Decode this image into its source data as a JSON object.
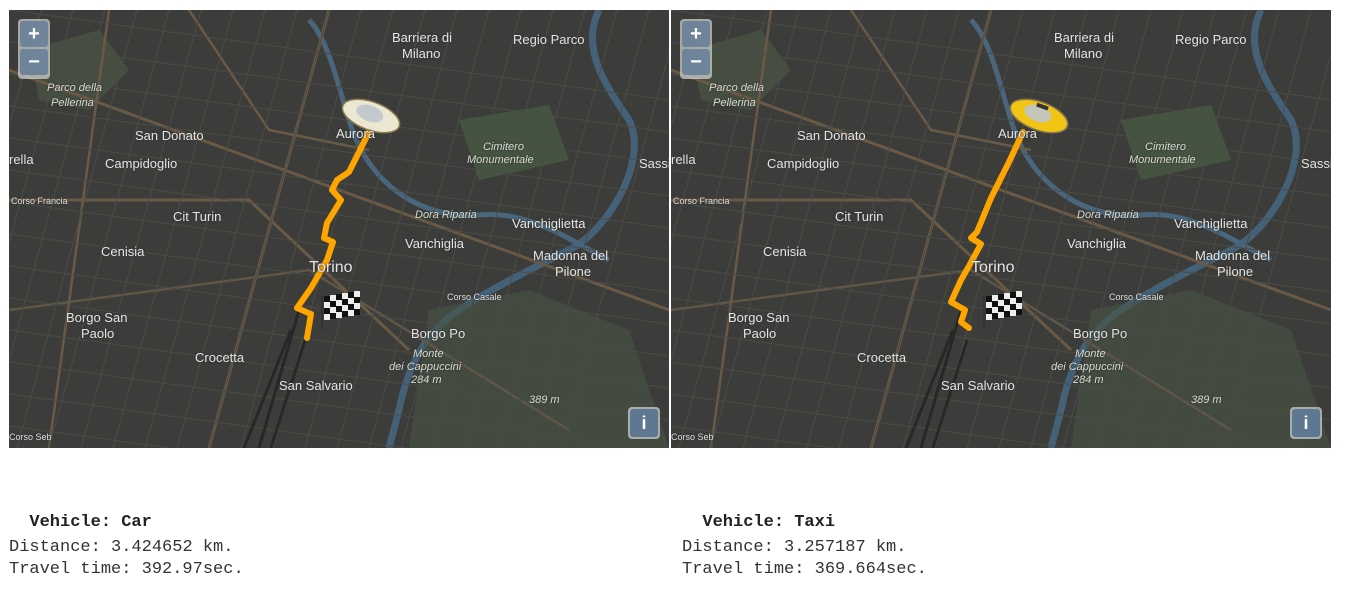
{
  "panels": [
    {
      "vehicle_label": "Vehicle:",
      "vehicle_name": "Car",
      "distance_label": "Distance:",
      "distance_value": "3.424652 km.",
      "time_label": "Travel time:",
      "time_value": "392.97sec.",
      "vehicle_icon": "car-icon",
      "vehicle_color": "#ece7d2"
    },
    {
      "vehicle_label": "Vehicle:",
      "vehicle_name": "Taxi",
      "distance_label": "Distance:",
      "distance_value": "3.257187 km.",
      "time_label": "Travel time:",
      "time_value": "369.664sec.",
      "vehicle_icon": "taxi-icon",
      "vehicle_color": "#f2c414"
    }
  ],
  "map": {
    "zoom_in": "+",
    "zoom_out": "−",
    "info": "i",
    "route_color": "#ffa500",
    "places": {
      "barriera": "Barriera di",
      "milano": "Milano",
      "regio_parco": "Regio Parco",
      "parco_pellerina_1": "Parco della",
      "parco_pellerina_2": "Pellerina",
      "san_donato": "San Donato",
      "aurora": "Aurora",
      "cimitero_1": "Cimitero",
      "cimitero_2": "Monumentale",
      "rella": "rella",
      "campidoglio": "Campidoglio",
      "sassi": "Sassi",
      "corso_francia": "Corso Francia",
      "dora_riparia": "Dora Riparia",
      "cit_turin": "Cit Turin",
      "vanchiglietta": "Vanchiglietta",
      "vanchiglia": "Vanchiglia",
      "cenisia": "Cenisia",
      "torino": "Torino",
      "madonna_1": "Madonna del",
      "madonna_2": "Pilone",
      "corso_casale": "Corso Casale",
      "borgo_san_paolo_1": "Borgo San",
      "borgo_san_paolo_2": "Paolo",
      "borgo_po": "Borgo Po",
      "crocetta": "Crocetta",
      "monte_1": "Monte",
      "monte_2": "dei Cappuccini",
      "monte_3": "284 m",
      "san_salvario": "San Salvario",
      "peak": "389 m",
      "corso_sebastopoli": "Corso Seb"
    }
  }
}
